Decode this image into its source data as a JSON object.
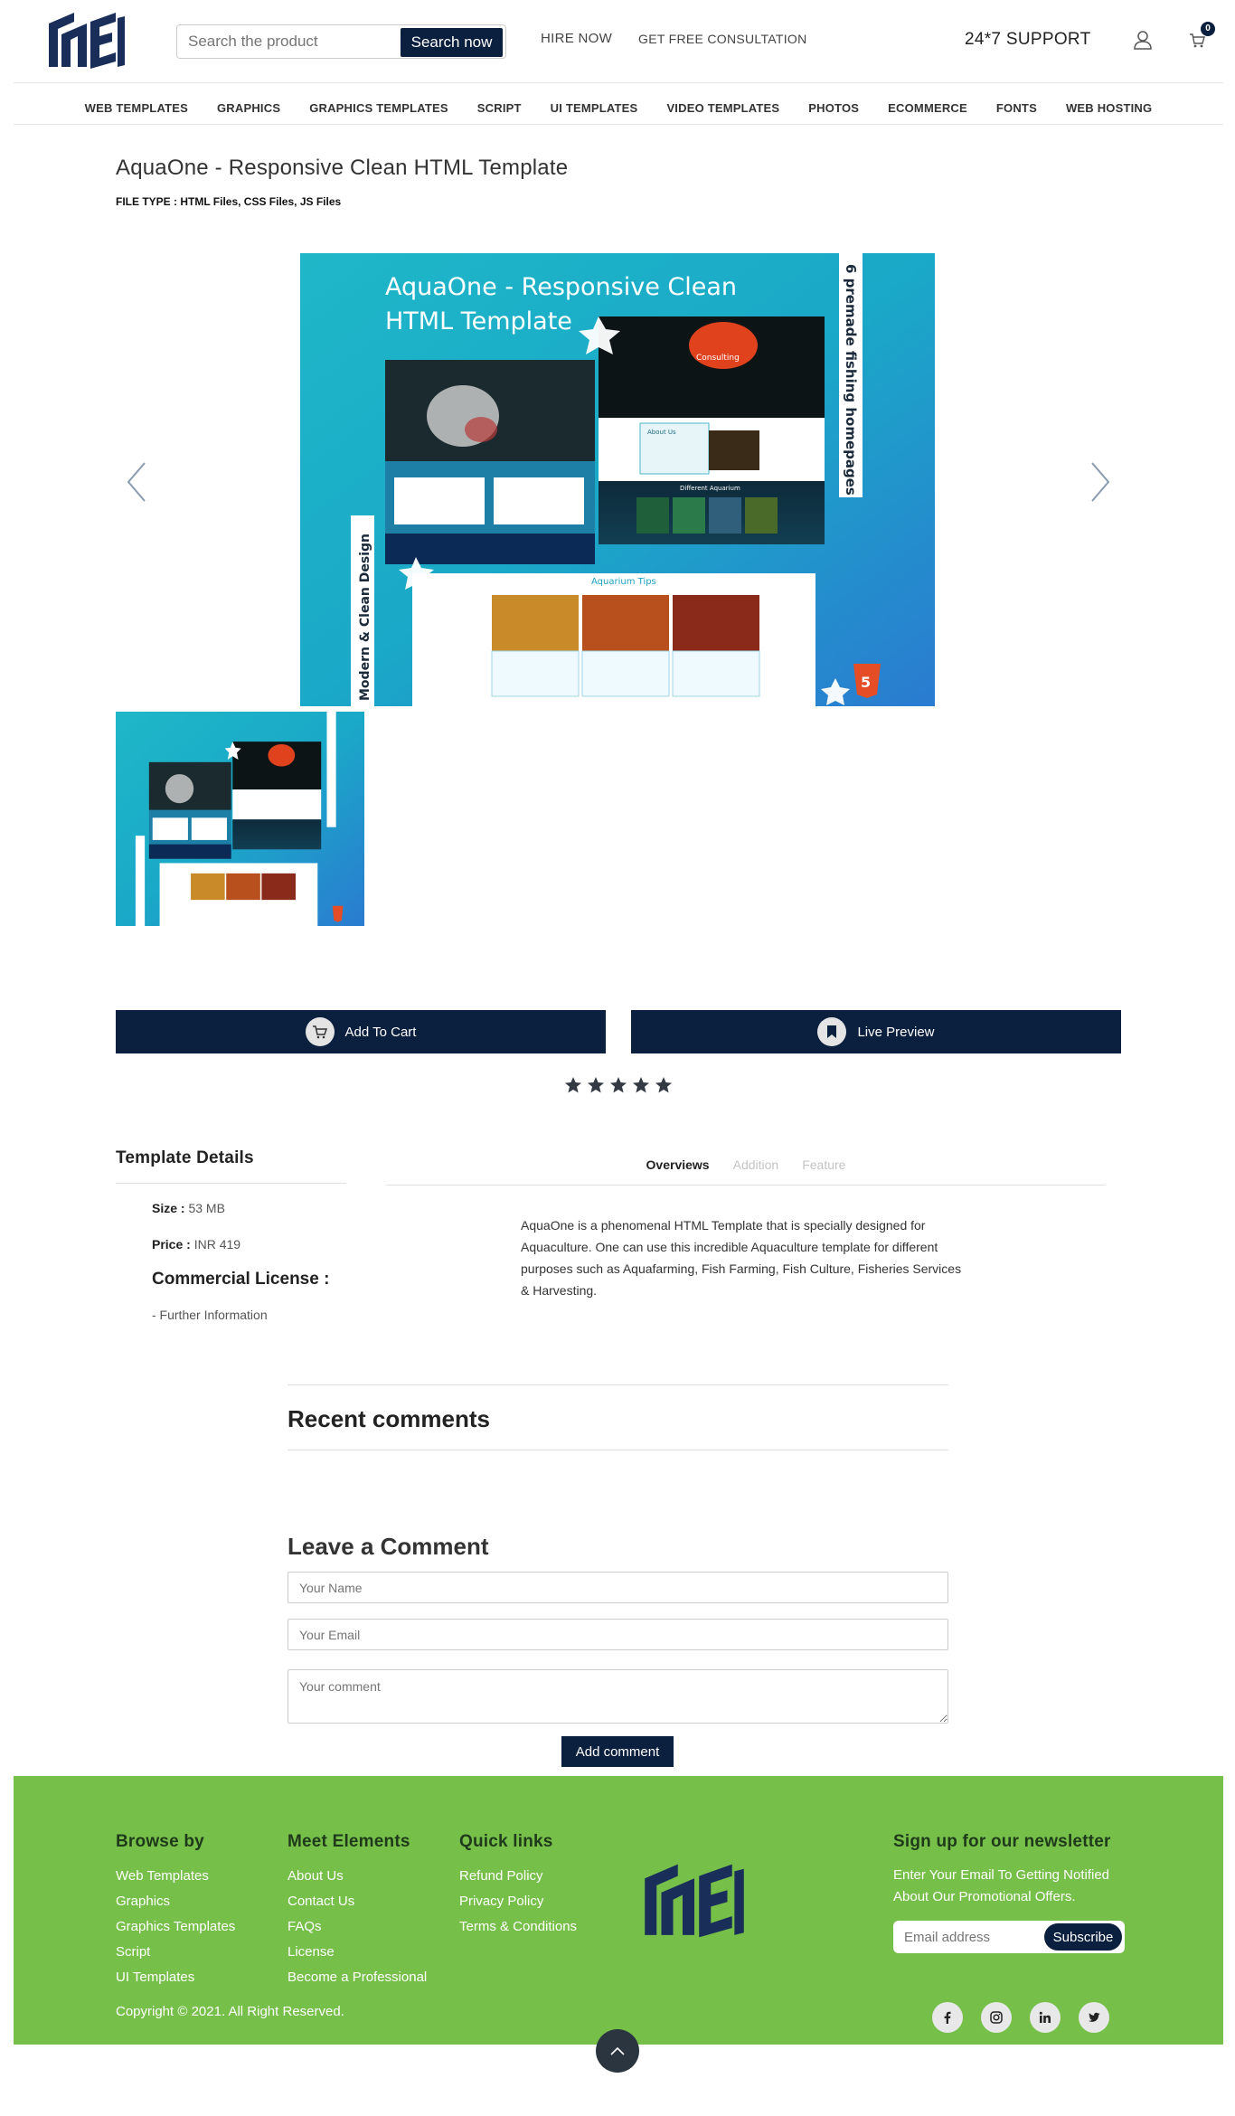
{
  "header": {
    "search_placeholder": "Search the product",
    "search_button": "Search now",
    "links": [
      "HIRE NOW",
      "GET FREE CONSULTATION"
    ],
    "support": "24*7 SUPPORT",
    "cart_count": "0"
  },
  "nav": {
    "items": [
      "WEB TEMPLATES",
      "GRAPHICS",
      "GRAPHICS TEMPLATES",
      "SCRIPT",
      "UI TEMPLATES",
      "VIDEO TEMPLATES",
      "PHOTOS",
      "ECOMMERCE",
      "FONTS",
      "WEB HOSTING"
    ]
  },
  "product": {
    "title": "AquaOne - Responsive Clean HTML Template",
    "file_type": "FILE TYPE : HTML Files, CSS Files, JS Files",
    "image": {
      "headline_line1": "AquaOne - Responsive Clean",
      "headline_line2": "HTML Template",
      "side_text": "6 premade fishing homepages",
      "left_text": "Modern & Clean Design",
      "section_tips": "Aquarium Tips",
      "section_about": "About Us",
      "section_aquarium": "Different Aquarium",
      "section_consulting": "Consulting"
    },
    "add_to_cart": "Add To Cart",
    "live_preview": "Live Preview",
    "rating": 5
  },
  "details": {
    "title": "Template Details",
    "size_label": "Size :",
    "size_value": "53 MB",
    "price_label": "Price :",
    "price_value": "INR 419",
    "license_title": "Commercial License :",
    "further": "- Further Information"
  },
  "tabs": {
    "items": [
      "Overviews",
      "Addition",
      "Feature"
    ],
    "active": 0,
    "overview_text": "AquaOne is a phenomenal HTML Template that is specially designed for Aquaculture. One can use this incredible Aquaculture template for different purposes such as Aquafarming, Fish Farming, Fish Culture, Fisheries Services & Harvesting."
  },
  "comments": {
    "recent_title": "Recent comments",
    "leave_title": "Leave a Comment",
    "name_placeholder": "Your Name",
    "email_placeholder": "Your Email",
    "comment_placeholder": "Your comment",
    "submit": "Add comment"
  },
  "footer": {
    "browse_title": "Browse by",
    "browse_links": [
      "Web Templates",
      "Graphics",
      "Graphics Templates",
      "Script",
      "UI Templates"
    ],
    "meet_title": "Meet Elements",
    "meet_links": [
      "About Us",
      "Contact Us",
      "FAQs",
      "License",
      "Become a Professional"
    ],
    "quick_title": "Quick links",
    "quick_links": [
      "Refund Policy",
      "Privacy Policy",
      "Terms & Conditions"
    ],
    "newsletter_title": "Sign up for our newsletter",
    "newsletter_text": "Enter Your Email To Getting Notified About Our Promotional Offers.",
    "email_placeholder": "Email address",
    "subscribe": "Subscribe",
    "copyright": "Copyright © 2021. All Right Reserved.",
    "social_icons": [
      "facebook-icon",
      "instagram-icon",
      "linkedin-icon",
      "twitter-icon"
    ]
  },
  "colors": {
    "navy": "#0b1f3f",
    "footer_green": "#76c04a",
    "logo_blue": "#1a2e5a"
  }
}
